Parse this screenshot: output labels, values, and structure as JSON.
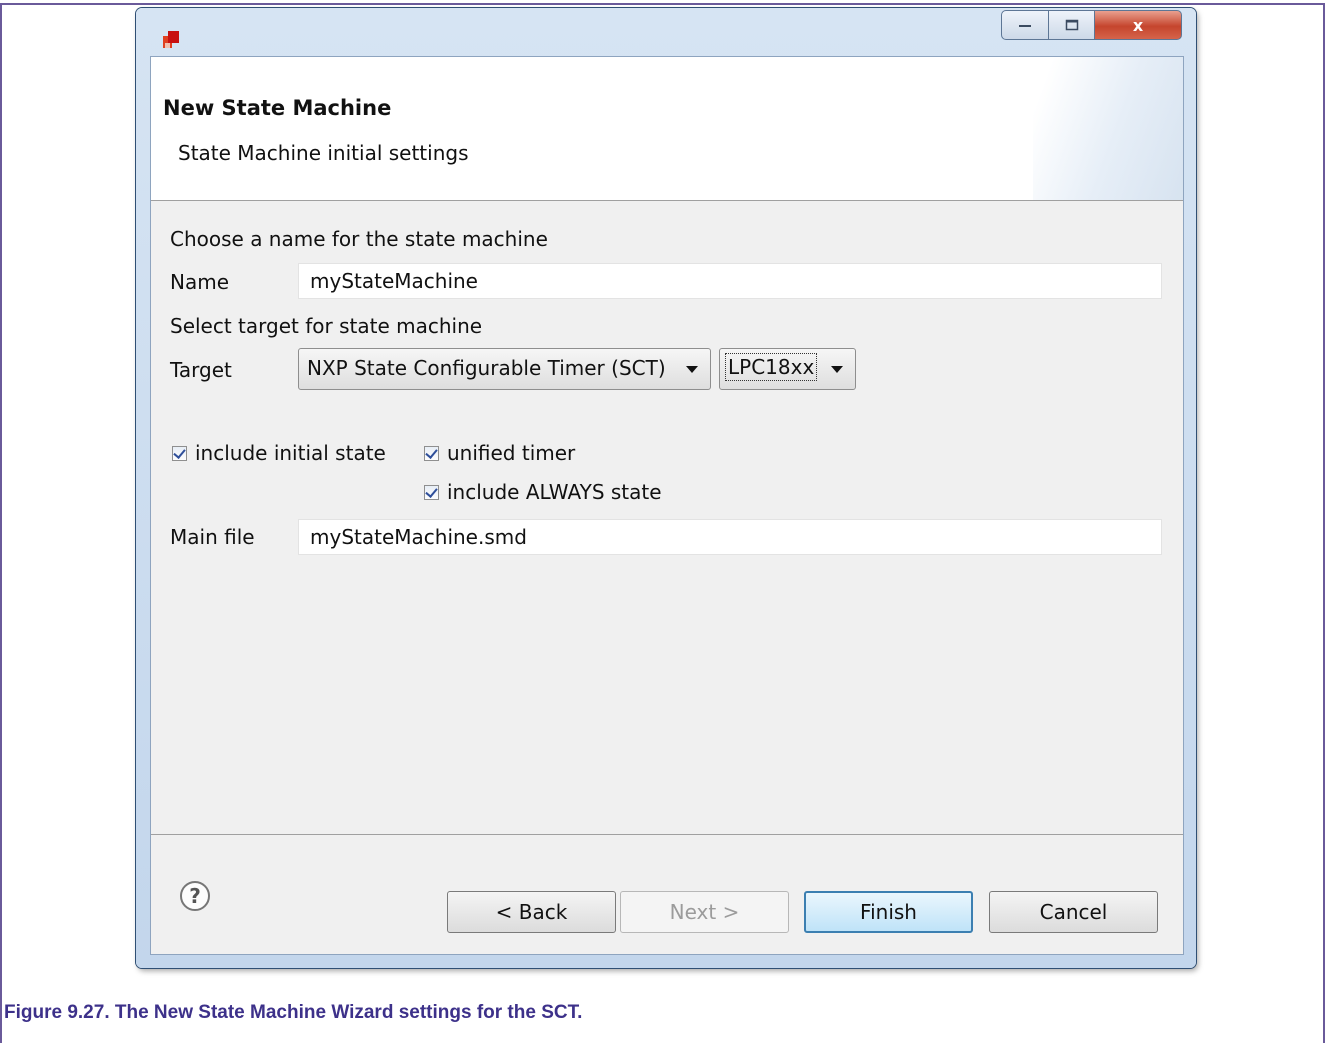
{
  "wizard": {
    "title": "New State Machine",
    "subtitle": "State Machine initial settings",
    "name_prompt": "Choose a name for the state machine",
    "name_label": "Name",
    "name_value": "myStateMachine",
    "target_prompt": "Select target for state machine",
    "target_label": "Target",
    "target_value": "NXP State Configurable Timer (SCT)",
    "variant_value": "LPC18xx",
    "checkboxes": {
      "include_initial_state": {
        "label": "include initial state",
        "checked": true
      },
      "unified_timer": {
        "label": "unified timer",
        "checked": true
      },
      "include_always_state": {
        "label": "include ALWAYS state",
        "checked": true
      }
    },
    "main_file_label": "Main file",
    "main_file_value": "myStateMachine.smd"
  },
  "buttons": {
    "help": "?",
    "back": "< Back",
    "next": "Next >",
    "finish": "Finish",
    "cancel": "Cancel"
  },
  "window": {
    "close_glyph": "x"
  },
  "caption": "Figure 9.27. The New State Machine Wizard settings for the SCT."
}
